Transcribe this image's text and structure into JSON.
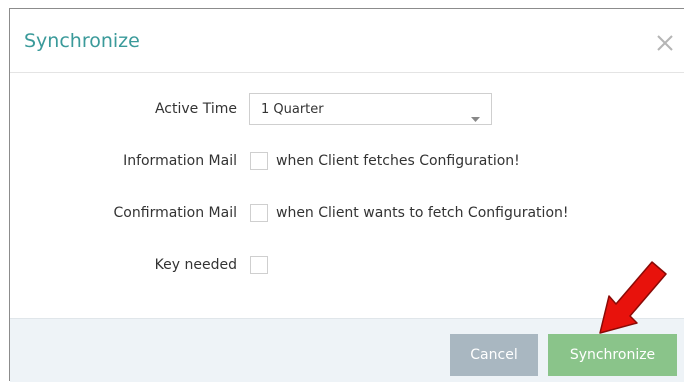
{
  "dialog": {
    "title": "Synchronize",
    "close_icon": "close-icon"
  },
  "form": {
    "active_time": {
      "label": "Active Time",
      "value": "1 Quarter",
      "caret_icon": "caret-down-icon"
    },
    "information_mail": {
      "label": "Information Mail",
      "checked": false,
      "text": "when Client fetches Configuration!"
    },
    "confirmation_mail": {
      "label": "Confirmation Mail",
      "checked": false,
      "text": "when Client wants to fetch Configuration!"
    },
    "key_needed": {
      "label": "Key needed",
      "checked": false
    }
  },
  "footer": {
    "cancel_label": "Cancel",
    "synchronize_label": "Synchronize"
  },
  "annotation": {
    "icon": "red-arrow-icon",
    "color": "#e8120c"
  },
  "colors": {
    "title": "#3a9a9a",
    "cancel_button": "#a9b7c1",
    "synchronize_button": "#8ac48a",
    "footer_background": "#eef3f7"
  }
}
